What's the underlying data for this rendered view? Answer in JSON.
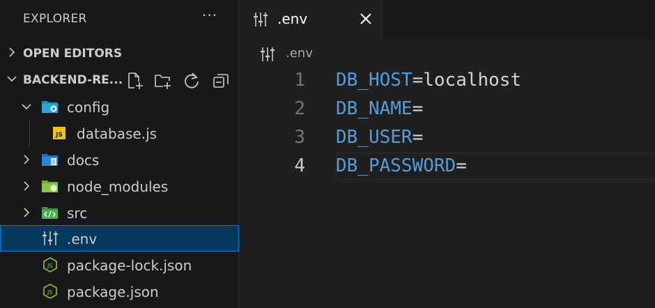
{
  "explorer": {
    "title": "EXPLORER",
    "more_label": "···",
    "sections": {
      "open_editors": "OPEN EDITORS",
      "project": "BACKEND-RE..."
    },
    "tree": {
      "config": "config",
      "database": "database.js",
      "docs": "docs",
      "node_modules": "node_modules",
      "src": "src",
      "env": ".env",
      "package_lock": "package-lock.json",
      "package": "package.json"
    },
    "js_badge": "JS"
  },
  "editor": {
    "tab_label": ".env",
    "breadcrumb": ".env",
    "lines": [
      {
        "num": "1",
        "key": "DB_HOST",
        "eq": "=",
        "value": "localhost"
      },
      {
        "num": "2",
        "key": "DB_NAME",
        "eq": "=",
        "value": ""
      },
      {
        "num": "3",
        "key": "DB_USER",
        "eq": "=",
        "value": ""
      },
      {
        "num": "4",
        "key": "DB_PASSWORD",
        "eq": "=",
        "value": ""
      }
    ]
  },
  "colors": {
    "accent": "#0078d4",
    "selected_bg": "#04395e",
    "key": "#569cd6"
  }
}
